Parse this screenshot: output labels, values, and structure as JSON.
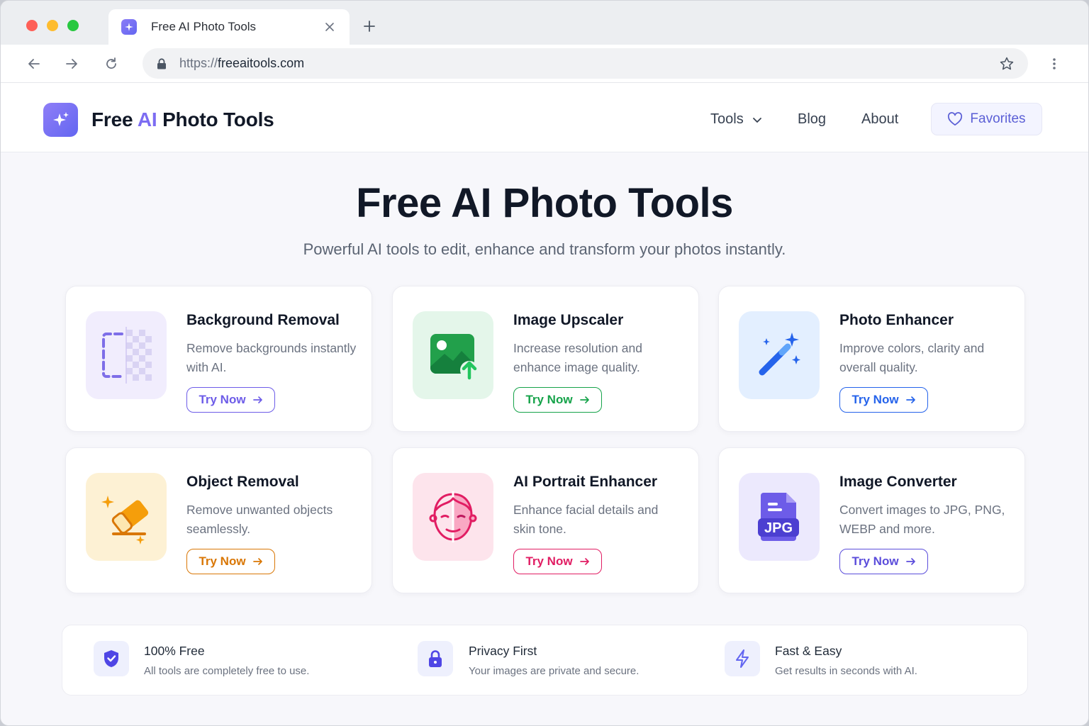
{
  "browser": {
    "tab_title": "Free AI Photo Tools",
    "url_scheme": "https://",
    "url_host": "freeaitools.com"
  },
  "site": {
    "logo_part1": "Free ",
    "logo_accent": "AI",
    "logo_part2": " Photo Tools",
    "accent_color": "#7c6cf2",
    "nav": {
      "tools": "Tools",
      "blog": "Blog",
      "about": "About",
      "favorites": "Favorites"
    }
  },
  "hero": {
    "title": "Free AI Photo Tools",
    "subtitle": "Powerful AI tools to edit, enhance and transform your photos instantly."
  },
  "tools": [
    {
      "title": "Background Removal",
      "desc": "Remove backgrounds instantly with AI.",
      "cta": "Try Now",
      "icon": "background-removal-icon",
      "color": "#6d5ce8",
      "icon_bg": "#f1edfd"
    },
    {
      "title": "Image Upscaler",
      "desc": "Increase resolution and enhance image quality.",
      "cta": "Try Now",
      "icon": "image-upscale-icon",
      "color": "#16a34a",
      "icon_bg": "#e4f6ea"
    },
    {
      "title": "Photo Enhancer",
      "desc": "Improve colors, clarity and overall quality.",
      "cta": "Try Now",
      "icon": "magic-wand-icon",
      "color": "#2563eb",
      "icon_bg": "#e3efff"
    },
    {
      "title": "Object Removal",
      "desc": "Remove unwanted objects seamlessly.",
      "cta": "Try Now",
      "icon": "eraser-icon",
      "color": "#d97706",
      "icon_bg": "#fdf1d4"
    },
    {
      "title": "AI Portrait Enhancer",
      "desc": "Enhance facial details and skin tone.",
      "cta": "Try Now",
      "icon": "face-icon",
      "color": "#e11d63",
      "icon_bg": "#fde4ec"
    },
    {
      "title": "Image Converter",
      "desc": "Convert images to JPG, PNG, WEBP and more.",
      "cta": "Try Now",
      "icon": "jpg-file-icon",
      "color": "#5b4ddb",
      "icon_bg": "#ece9fd",
      "badge": "JPG"
    }
  ],
  "features": [
    {
      "title": "100% Free",
      "desc": "All tools are completely free to use.",
      "icon": "shield-check-icon"
    },
    {
      "title": "Privacy First",
      "desc": "Your images are private and secure.",
      "icon": "lock-icon"
    },
    {
      "title": "Fast & Easy",
      "desc": "Get results in seconds with AI.",
      "icon": "lightning-icon"
    }
  ]
}
